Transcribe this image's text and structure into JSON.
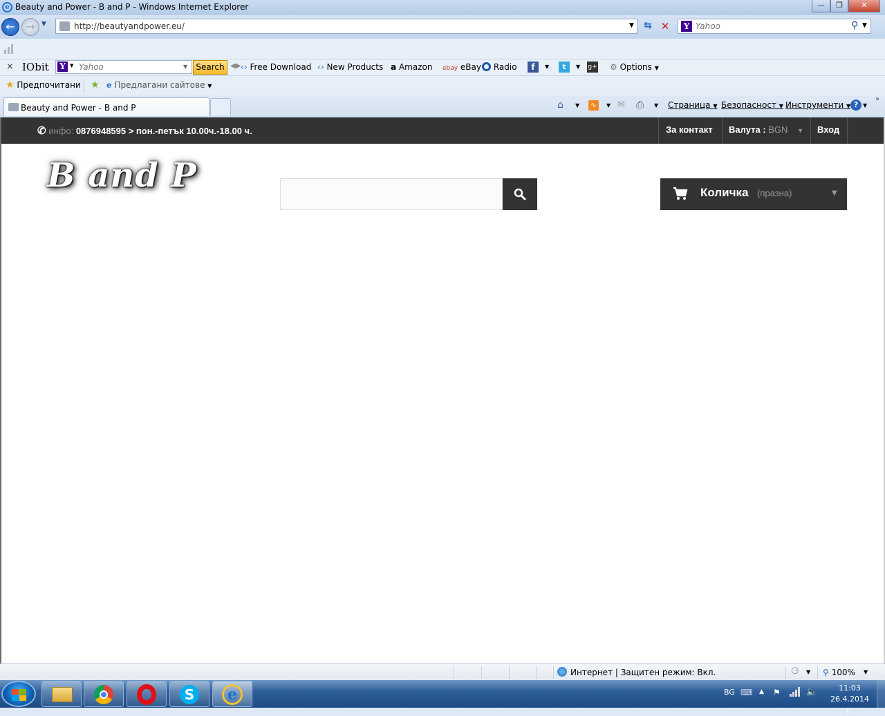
{
  "window": {
    "title": "Beauty and Power - B and P - Windows Internet Explorer"
  },
  "address_bar": {
    "url": "http://beautyandpower.eu/",
    "search_placeholder": "Yahoo"
  },
  "toolbar": {
    "brand": "IObit",
    "yahoo_placeholder": "Yahoo",
    "search_button": "Search",
    "links": [
      "Free Download",
      "New Products",
      "Amazon",
      "eBay",
      "Radio"
    ],
    "ebay_logo": "ebay",
    "options": "Options"
  },
  "favorites_bar": {
    "favorites": "Предпочитани",
    "suggested_sites": "Предлагани сайтове"
  },
  "tabs": [
    {
      "label": "Beauty and Power - B and P"
    }
  ],
  "command_bar": {
    "page": "Страница",
    "safety": "Безопасност",
    "tools": "Инструменти"
  },
  "site": {
    "topbar": {
      "info_label": "инфо:",
      "info_text": "0876948595 > пон.-петък 10.00ч.-18.00 ч.",
      "contact": "За контакт",
      "currency_label": "Валута :",
      "currency_value": "BGN",
      "login": "Вход"
    },
    "logo_text": "B and P",
    "cart": {
      "label": "Количка",
      "status": "(празна)"
    }
  },
  "status_bar": {
    "zone": "Интернет | Защитен режим: Вкл.",
    "zoom": "100%"
  },
  "taskbar": {
    "language": "BG",
    "time": "11:03",
    "date": "26.4.2014 г."
  },
  "colors": {
    "site_dark": "#333333",
    "currency_value": "#999999",
    "cart_status": "#999999",
    "yahoo_purple": "#400090"
  }
}
